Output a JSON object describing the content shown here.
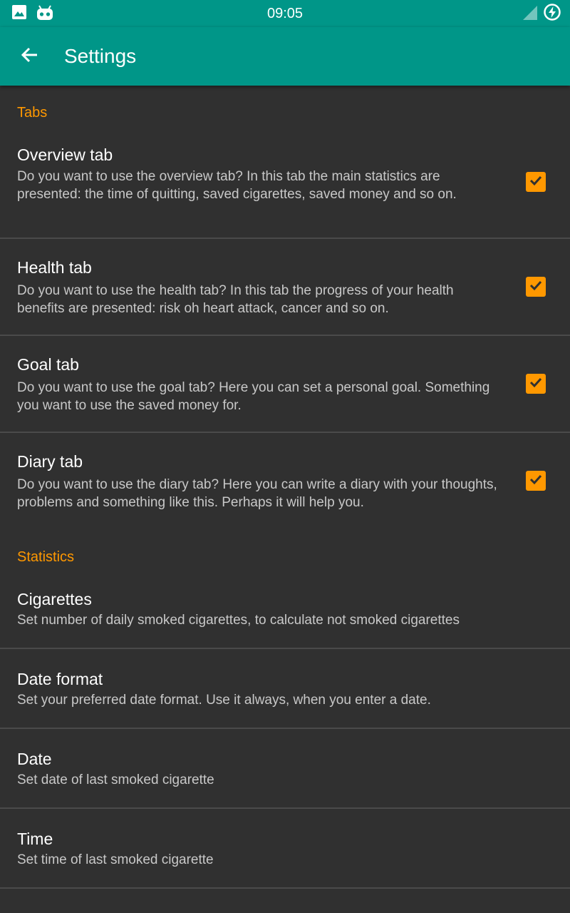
{
  "status_bar": {
    "time": "09:05",
    "left_icons": [
      "image-icon",
      "android-icon"
    ],
    "right_icons": [
      "signal-icon",
      "battery-charging-icon"
    ]
  },
  "toolbar": {
    "title": "Settings",
    "back_icon": "arrow-back-icon"
  },
  "colors": {
    "primary": "#009688",
    "accent": "#ff9800",
    "background": "#303030",
    "divider": "#4a4a4a"
  },
  "sections": [
    {
      "header": "Tabs",
      "items": [
        {
          "title": "Overview tab",
          "summary": "Do you want to use the overview tab? In this tab the main statistics are presented: the time of quitting, saved cigarettes, saved money and so on.",
          "checked": true
        },
        {
          "title": "Health tab",
          "summary": "Do you want to use the health tab? In this tab the progress of your health benefits are presented: risk oh heart attack, cancer and so on.",
          "checked": true
        },
        {
          "title": "Goal tab",
          "summary": "Do you want to use the goal tab? Here you can set a personal goal. Something you want to use the saved money for.",
          "checked": true
        },
        {
          "title": "Diary tab",
          "summary": "Do you want to use the diary tab? Here you can write a diary with your thoughts, problems and something like this. Perhaps it will help you.",
          "checked": true
        }
      ]
    },
    {
      "header": "Statistics",
      "items": [
        {
          "title": "Cigarettes",
          "summary": "Set number of daily smoked cigarettes, to calculate not smoked cigarettes"
        },
        {
          "title": "Date format",
          "summary": "Set your preferred date format. Use it always, when you enter a date."
        },
        {
          "title": "Date",
          "summary": "Set date of last smoked cigarette"
        },
        {
          "title": "Time",
          "summary": "Set time of last smoked cigarette"
        }
      ]
    }
  ]
}
